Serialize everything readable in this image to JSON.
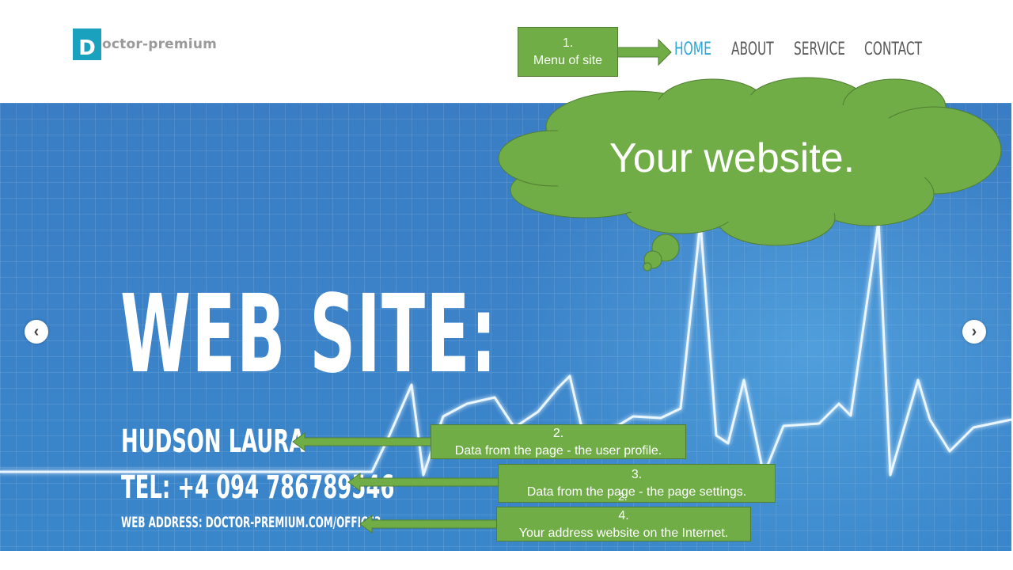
{
  "header": {
    "logo_letter": "D",
    "logo_text": "octor-premium",
    "nav": [
      "HOME",
      "ABOUT",
      "SERVICE",
      "CONTACT"
    ],
    "active_nav": "HOME"
  },
  "hero": {
    "title": "WEB SITE:",
    "name": "HUDSON LAURA",
    "tel": "TEL: +4 094 786789546",
    "web_address": "WEB ADDRESS: DOCTOR-PREMIUM.COM/OFFICE3",
    "prev_icon": "chevron-left-icon",
    "next_icon": "chevron-right-icon"
  },
  "annotations": {
    "menu_num": "1.",
    "menu_text": "Menu of site",
    "cloud_text": "Your website.",
    "profile_num": "2.",
    "profile_text": "Data from the page - the user profile.",
    "settings_num": "3.",
    "settings_text": "Data from the page - the page settings.",
    "settings_overlap": "2.",
    "address_num": "4.",
    "address_text": "Your address  website on the Internet."
  },
  "colors": {
    "annotation_green": "#70ad47",
    "active_nav": "#2aa8d8",
    "logo_teal": "#1aa1bd",
    "hero_blue": "#3b82c8"
  }
}
